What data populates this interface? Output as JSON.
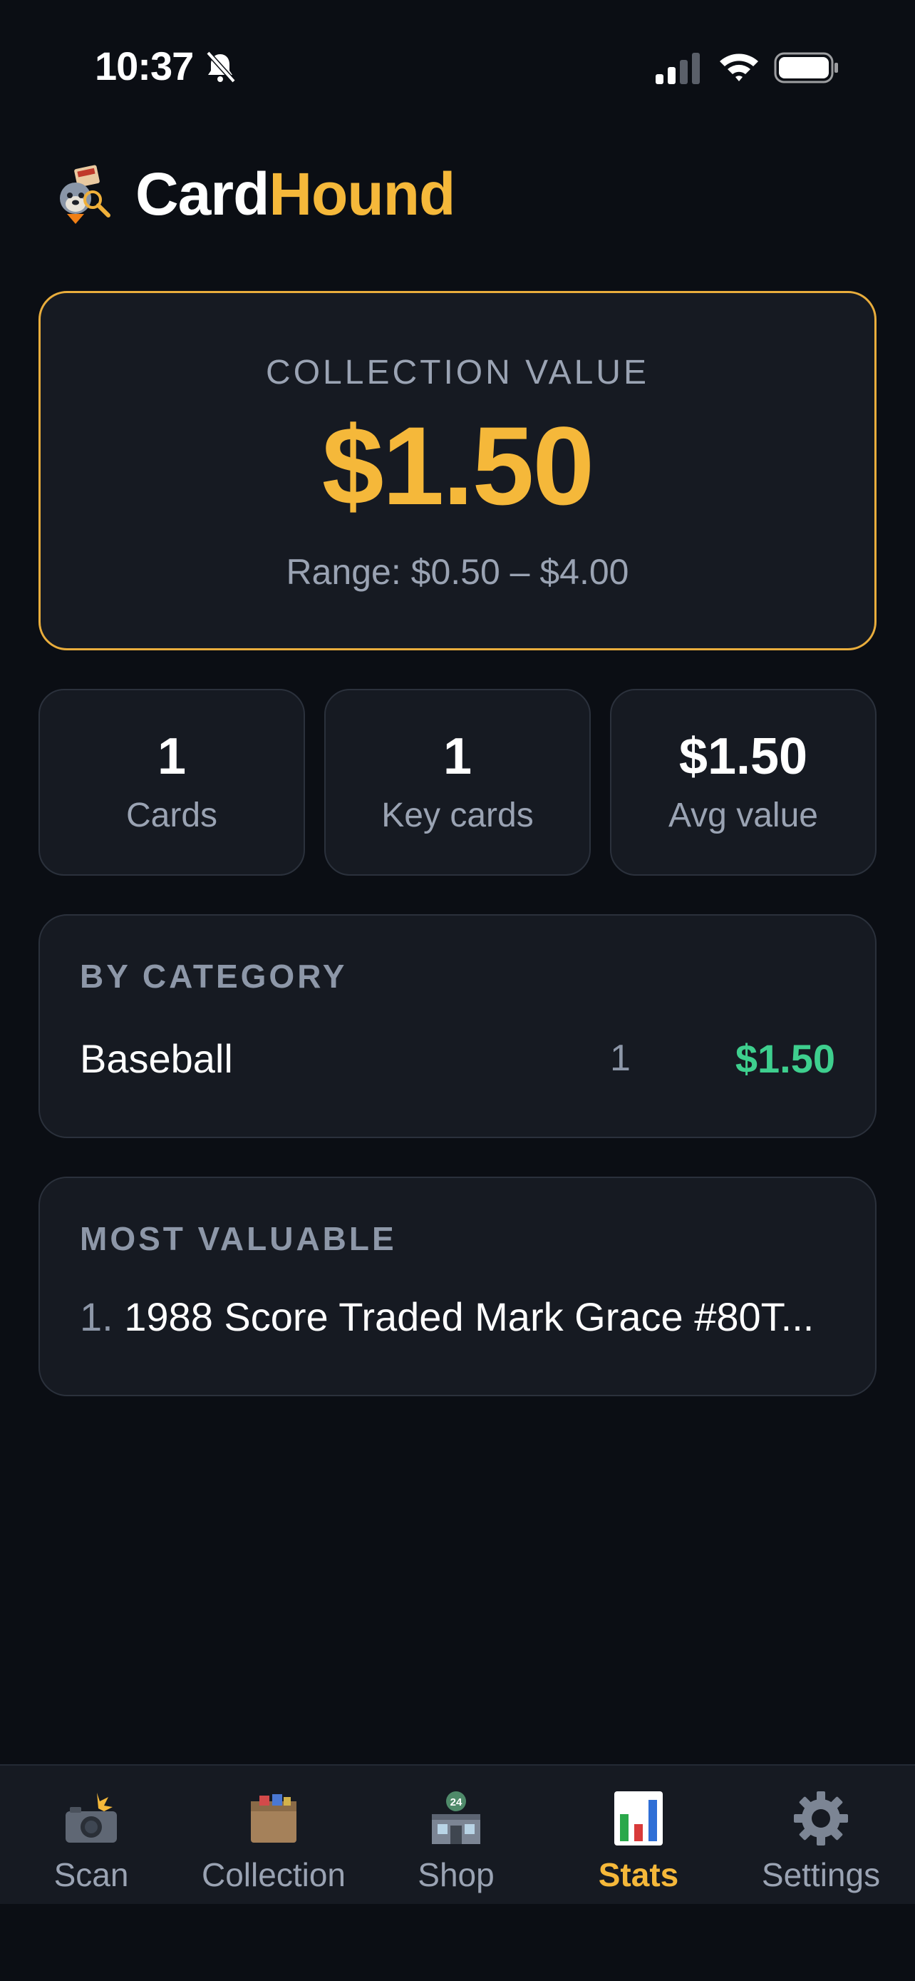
{
  "status_bar": {
    "time": "10:37"
  },
  "header": {
    "brand_part1": "Card",
    "brand_part2": "Hound"
  },
  "collection": {
    "label": "COLLECTION VALUE",
    "amount": "$1.50",
    "range": "Range: $0.50 – $4.00"
  },
  "stats": [
    {
      "value": "1",
      "label": "Cards"
    },
    {
      "value": "1",
      "label": "Key cards"
    },
    {
      "value": "$1.50",
      "label": "Avg value"
    }
  ],
  "by_category": {
    "title": "BY CATEGORY",
    "rows": [
      {
        "name": "Baseball",
        "count": "1",
        "value": "$1.50"
      }
    ]
  },
  "most_valuable": {
    "title": "MOST VALUABLE",
    "items": [
      {
        "rank": "1.",
        "name": "1988 Score Traded Mark Grace #80T..."
      }
    ]
  },
  "tabs": [
    {
      "label": "Scan",
      "icon": "camera-flash-icon"
    },
    {
      "label": "Collection",
      "icon": "box-icon"
    },
    {
      "label": "Shop",
      "icon": "convenience-store-icon"
    },
    {
      "label": "Stats",
      "icon": "bar-chart-icon",
      "active": true
    },
    {
      "label": "Settings",
      "icon": "gear-icon"
    }
  ],
  "colors": {
    "accent": "#f5b83a",
    "positive": "#3ecf8e",
    "background": "#0b0e14",
    "card": "#161a22"
  }
}
